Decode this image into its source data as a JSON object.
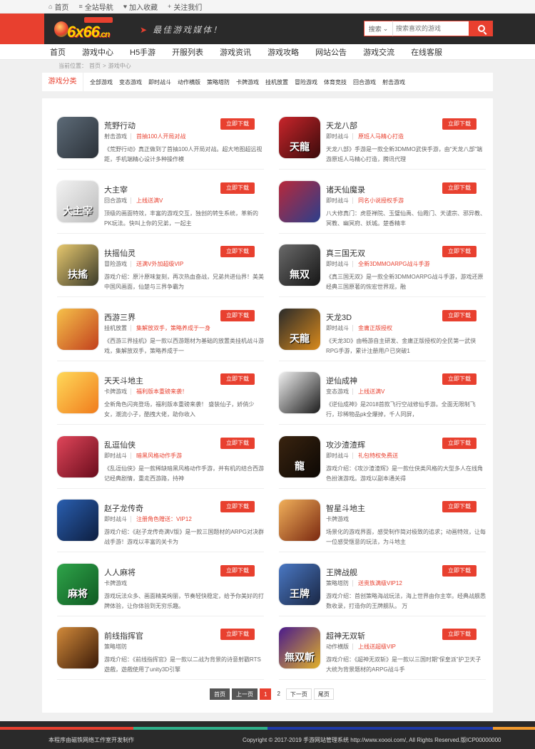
{
  "topbar": [
    {
      "icon": "home-icon",
      "glyph": "⌂",
      "label": "首页"
    },
    {
      "icon": "menu-icon",
      "glyph": "≡",
      "label": "全站导航"
    },
    {
      "icon": "heart-icon",
      "glyph": "♥",
      "label": "加入收藏"
    },
    {
      "icon": "plus-icon",
      "glyph": "+",
      "label": "关注我们"
    }
  ],
  "header": {
    "logo_text": "6x66",
    "logo_suffix": ".cn",
    "slogan": "最佳游戏媒体！",
    "search_select": "搜索",
    "search_placeholder": "搜索喜欢的游戏",
    "accent_color": "#e8402f"
  },
  "nav": [
    "首页",
    "游戏中心",
    "H5手游",
    "开服列表",
    "游戏资讯",
    "游戏攻略",
    "网站公告",
    "游戏交流",
    "在线客服"
  ],
  "breadcrumb": {
    "prefix": "当前位置：",
    "home": "首页",
    "sep": ">",
    "current": "游戏中心"
  },
  "categories": {
    "title": "游戏分类",
    "items": [
      "全部游戏",
      "变态游戏",
      "即时战斗",
      "动作横版",
      "策略塔防",
      "卡牌游戏",
      "挂机放置",
      "冒险游戏",
      "体育竞技",
      "回合游戏",
      "射击游戏"
    ]
  },
  "download_label": "立即下载",
  "games": [
    {
      "name": "荒野行动",
      "type": "射击游戏",
      "gift": "首抽100人开局对战",
      "desc": "《荒野行动》真正做到了首抽100人开局对战。超大地图超远视距，手机端精心设计多种操作模",
      "icon_text": "",
      "c1": "#5d6b78",
      "c2": "#2b3138"
    },
    {
      "name": "天龙八部",
      "type": "即时战斗",
      "gift": "原班人马精心打造",
      "desc": "天龙八部》手游是一款全新3DMMO武侠手游，由“天龙八部”端游原班人马精心打造，腾讯代理",
      "icon_text": "天龍",
      "c1": "#c9252b",
      "c2": "#3a0b0b"
    },
    {
      "name": "大主宰",
      "type": "回合游戏",
      "gift": "上线送满V",
      "desc": "顶级的画面特效，丰富的游戏交互，独创的转生系统，革新的PK玩法。快叫上你的兄弟，一起主",
      "icon_text": "大主宰",
      "c1": "#f2f2f2",
      "c2": "#bdbdbd"
    },
    {
      "name": "诸天仙魔录",
      "type": "即时战斗",
      "gift": "同名小说授权手游",
      "desc": "八大修真门：虎臣禅院、玉璧仙禹、仙霞门、天谴宗、邪异教、冥教、幽冥府、妖城。楚香精丰",
      "icon_text": "",
      "c1": "#b8283a",
      "c2": "#2b3f8c"
    },
    {
      "name": "扶摇仙灵",
      "type": "冒险游戏",
      "gift": "送满V外加超级VIP",
      "desc": "游戏介绍：原汁原味复刻，再次热血奋战，兄弟共进仙界！美美中国风画面，仙楚与三界争霸为",
      "icon_text": "扶搖",
      "c1": "#e7c86e",
      "c2": "#3a3a2a"
    },
    {
      "name": "真三国无双",
      "type": "即时战斗",
      "gift": "全新3DMMOARPG战斗手游",
      "desc": "《真三国无双》是一款全新3DMMOARPG战斗手游，游戏还原经典三国原著的恢宏世界观，融",
      "icon_text": "無双",
      "c1": "#6a6a6a",
      "c2": "#161616"
    },
    {
      "name": "西游三界",
      "type": "挂机放置",
      "gift": "集解放双手，策略养成于一身",
      "desc": "《西游三界挂机》是一款以西游题材为基础的放置类挂机战斗游戏，集解放双手，策略养成于一",
      "icon_text": "",
      "c1": "#f6c14a",
      "c2": "#c2401d"
    },
    {
      "name": "天龙3D",
      "type": "即时战斗",
      "gift": "金庸正版授权",
      "desc": "《天龙3D》由畅游自主研发、金庸正版授权的全民第一武侠RPG手游，累计注册用户已突破1",
      "icon_text": "天龍",
      "c1": "#2a2a2a",
      "c2": "#d98a1c"
    },
    {
      "name": "天天斗地主",
      "type": "卡牌游戏",
      "gift": "福利版本重磅来袭！",
      "desc": "全新角色闪亮登场，福利版本重磅来袭！ 盛装仙子，娇俏少女，潮流小子，酷拽大佬，助你收入",
      "icon_text": "",
      "c1": "#ffd95a",
      "c2": "#f07c1c"
    },
    {
      "name": "逆仙成神",
      "type": "变态游戏",
      "gift": "上线送满V",
      "desc": "《逆仙成神》是2018首款飞行空战修仙手游。全面无限制飞行，珍稀物品pk全爆掉，千人同屏，",
      "icon_text": "",
      "c1": "#f0f0f0",
      "c2": "#1c1c1c"
    },
    {
      "name": "乱逗仙侠",
      "type": "即时战斗",
      "gift": "暗黑风格动作手游",
      "desc": "《乱逗仙侠》是一款稀缺暗黑风格动作手游，并有机的结合西游记经典剧情，重走西游路，持神",
      "icon_text": "",
      "c1": "#e0465a",
      "c2": "#6a0c1c"
    },
    {
      "name": "攻沙渣渣辉",
      "type": "即时战斗",
      "gift": "礼包特权免费送",
      "desc": "游戏介绍：《攻沙渣渣辉》是一款仕侠类风格的大型多人在线角色扮演游戏。游戏以副本通关得",
      "icon_text": "龍",
      "c1": "#3a2410",
      "c2": "#0c0804"
    },
    {
      "name": "赵子龙传奇",
      "type": "即时战斗",
      "gift": "注册角色赠送：VIP12",
      "desc": "游戏介绍：《赵子龙传奇满V版》是一款三国题材的ARPG对决群战手游！游戏以丰富的关卡为",
      "icon_text": "",
      "c1": "#2a5fb0",
      "c2": "#0d1e40"
    },
    {
      "name": "智星斗地主",
      "type": "卡牌游戏",
      "gift": "",
      "desc": "场景化的游戏界面，感受制作简对极致的追求；动画特效，让每一位感受惬意的玩法，为斗地主",
      "icon_text": "",
      "c1": "#f1b05a",
      "c2": "#7a2810"
    },
    {
      "name": "人人麻将",
      "type": "卡牌游戏",
      "gift": "",
      "desc": "游戏玩法众多、画面精美绚丽，节奏轻快稳定，给予你美好的打牌体验，让你体验到无穷乐趣。",
      "icon_text": "麻将",
      "c1": "#2fa44a",
      "c2": "#0f5a22"
    },
    {
      "name": "王牌战舰",
      "type": "策略塔防",
      "gift": "送贵族满级VIP12",
      "desc": "游戏介绍：首创策略海战玩法，海上世界由你主宰。经典战舰悉数收录，打造你的王牌舰队。 万",
      "icon_text": "王牌",
      "c1": "#4a78c4",
      "c2": "#1a2744"
    },
    {
      "name": "前线指挥官",
      "type": "策略塔防",
      "gift": "",
      "desc": "游戏介绍：《前线指挥官》是一款以二战为背景的诗意射戳RTS遊戲，遊戲使用了unity3D引擎",
      "icon_text": "",
      "c1": "#d28a3a",
      "c2": "#3a1a08"
    },
    {
      "name": "超神无双斩",
      "type": "动作横版",
      "gift": "上线送超级VIP",
      "desc": "游戏介绍：《超神无双斩》是一款以三国时期“保皇派”护卫天子大统为背景题材的ARPG战斗手",
      "icon_text": "無双斬",
      "c1": "#4a1a8c",
      "c2": "#e0b02a"
    }
  ],
  "pagination": [
    {
      "label": "首页",
      "style": "dark"
    },
    {
      "label": "上一页",
      "style": "dark"
    },
    {
      "label": "1",
      "style": "cur"
    },
    {
      "label": "2",
      "style": "plain"
    },
    {
      "label": "下一页",
      "style": "normal"
    },
    {
      "label": "尾页",
      "style": "normal"
    }
  ],
  "footer": {
    "left": "本程序由磁铁网络工作室开发制作",
    "right": "Copyright © 2017-2019 手游网站管理系统 http://www.xoooi.com/, All Rights Reserved.版ICP00000000",
    "bar_colors": [
      "#e8402f",
      "#2fb08a",
      "#1f3aa8",
      "#f29a2e"
    ]
  }
}
